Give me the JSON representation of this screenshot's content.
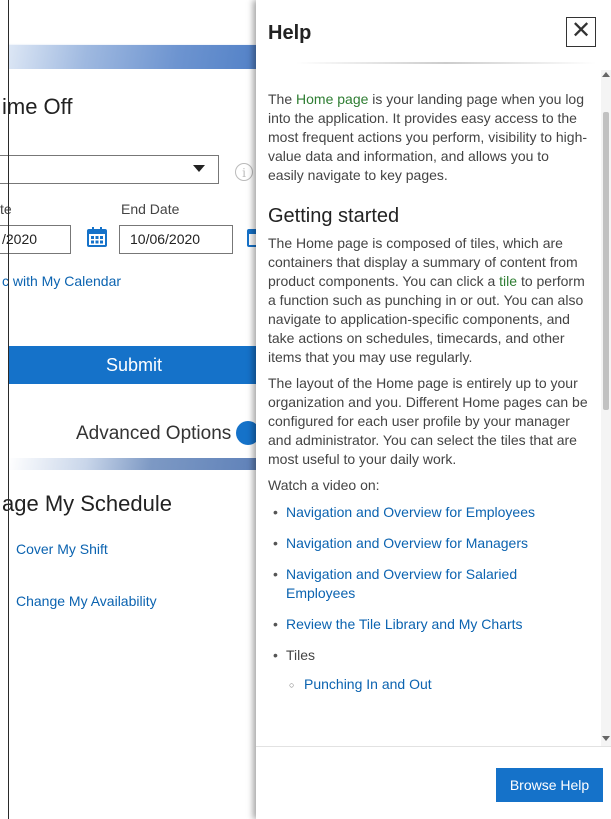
{
  "left_app": {
    "time_off_title": "ime Off",
    "start_date_label": "te",
    "end_date_label": "End Date",
    "start_date_value": "/2020",
    "end_date_value": "10/06/2020",
    "sync_calendar_link": "c with My Calendar",
    "submit_label": "Submit",
    "advanced_options_label": "Advanced Options",
    "schedule_title": "age My Schedule",
    "schedule_links": [
      "Cover My Shift",
      "Change My Availability"
    ],
    "info_icon": "info-icon",
    "calendar_icon": "calendar-icon"
  },
  "help": {
    "title": "Help",
    "close_icon_glyph": "✕",
    "intro": {
      "highlight": "Home page",
      "text": " is your landing page when you log into the application. It provides easy access to the most frequent actions you perform, visibility to high-value data and information, and allows you to easily navigate to key pages.",
      "prefix": "The "
    },
    "getting_started_heading": "Getting started",
    "p1_before": "The Home page is composed of tiles, which are containers that display a summary of content from product components. You can click a ",
    "p1_highlight": "tile",
    "p1_after": " to perform a function such as punching in or out. You can also navigate to application-specific components, and take actions on schedules, timecards, and other items that you may use regularly.",
    "p2": "The layout of the Home page is entirely up to your organization and you. Different Home pages can be configured for each user profile by your manager and administrator. You can select the tiles that are most useful to your daily work.",
    "watch_label": "Watch a video on:",
    "video_links": [
      "Navigation and Overview for Employees",
      "Navigation and Overview for Managers",
      "Navigation and Overview for Salaried Employees",
      "Review the Tile Library and My Charts"
    ],
    "tiles_label": "Tiles",
    "tiles_sub": [
      "Punching In and Out"
    ],
    "browse_help_label": "Browse Help"
  },
  "colors": {
    "primary_blue": "#1572c9",
    "link_blue": "#0b63b0",
    "highlight_green": "#2e7d32"
  }
}
